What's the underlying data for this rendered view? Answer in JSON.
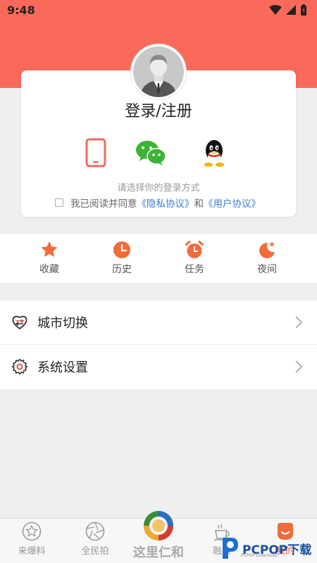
{
  "status_bar": {
    "time": "9:48"
  },
  "login": {
    "title": "登录/注册",
    "choose_text": "请选择你的登录方式",
    "agree_prefix": "我已阅读并同意",
    "privacy_link": "《隐私协议》",
    "and_text": "和",
    "user_link": "《用户协议》",
    "methods": [
      "phone-icon",
      "wechat-icon",
      "qq-icon"
    ]
  },
  "quick_actions": [
    {
      "label": "收藏",
      "icon": "star-icon"
    },
    {
      "label": "历史",
      "icon": "clock-icon"
    },
    {
      "label": "任务",
      "icon": "alarm-icon"
    },
    {
      "label": "夜间",
      "icon": "moon-icon"
    }
  ],
  "menu": [
    {
      "label": "城市切换",
      "icon": "city-switch-icon"
    },
    {
      "label": "系统设置",
      "icon": "gear-icon"
    }
  ],
  "tabbar": {
    "tabs": [
      {
        "label": "来爆料",
        "icon": "star-circle-icon"
      },
      {
        "label": "全民拍",
        "icon": "aperture-icon"
      },
      {
        "label": "这里仁和",
        "icon": "app-logo-icon"
      },
      {
        "label": "融媒",
        "icon": "coffee-icon"
      },
      {
        "label": "我的",
        "icon": "profile-icon"
      }
    ]
  },
  "watermark": {
    "text": "PCPOP下载",
    "sub": "PCPOP Download"
  },
  "colors": {
    "accent": "#fa6a5a",
    "link": "#3a7bd5",
    "icon_orange": "#f26b3a"
  }
}
